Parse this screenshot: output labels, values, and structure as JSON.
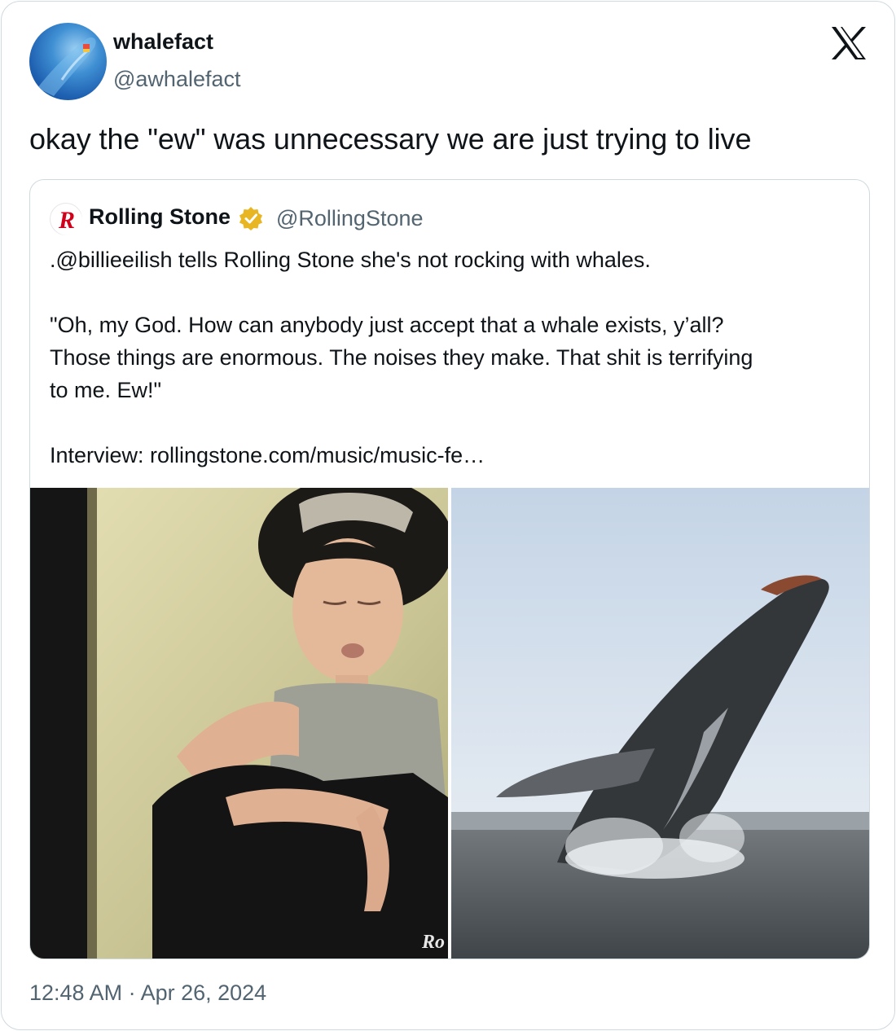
{
  "author": {
    "name": "whalefact",
    "handle": "@awhalefact"
  },
  "platform_logo": "x-logo-icon",
  "tweet": {
    "text": "okay the \"ew\" was unnecessary we are just trying to live"
  },
  "quoted": {
    "name": "Rolling Stone",
    "handle": "@RollingStone",
    "verified": "gold-verified-badge-icon",
    "lines": [
      ".@billieeilish tells Rolling Stone she's not rocking with whales.",
      "",
      "\"Oh, my God. How can anybody just accept that a whale exists, y’all?",
      "Those things are enormous. The noises they make. That shit is terrifying",
      "to me. Ew!\"",
      "",
      "Interview: rollingstone.com/music/music-fe…"
    ],
    "images": [
      {
        "name": "photo-billie-eilish",
        "watermark": "Ro"
      },
      {
        "name": "photo-breaching-whale"
      }
    ]
  },
  "timestamp": "12:48 AM · Apr 26, 2024",
  "colors": {
    "text": "#0f1419",
    "secondary": "#536471",
    "border": "#cfd9de",
    "verified": "#e8b622",
    "rs_red": "#d0021b"
  }
}
